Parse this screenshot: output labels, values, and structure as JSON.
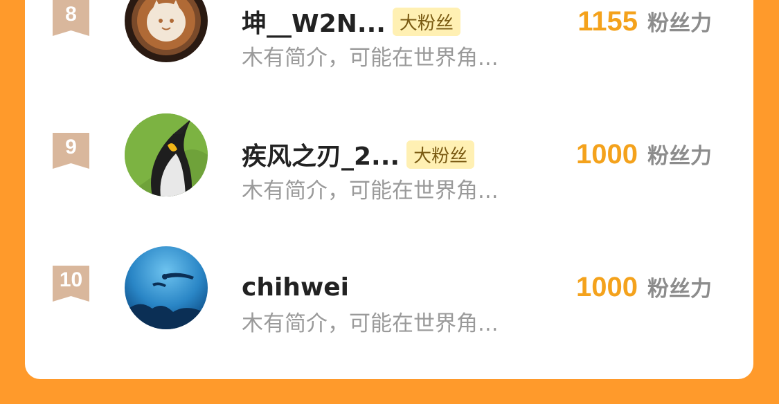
{
  "ranking": {
    "rows": [
      {
        "rank": "8",
        "name": "坤__W2N...",
        "badge": "大粉丝",
        "bio": "木有简介，可能在世界角...",
        "score": "1155",
        "score_unit": "粉丝力",
        "avatar_icon": "latte-art-cat-avatar"
      },
      {
        "rank": "9",
        "name": "疾风之刃_2...",
        "badge": "大粉丝",
        "bio": "木有简介，可能在世界角...",
        "score": "1000",
        "score_unit": "粉丝力",
        "avatar_icon": "penguin-avatar"
      },
      {
        "rank": "10",
        "name": "chihwei",
        "badge": "",
        "bio": "木有简介，可能在世界角...",
        "score": "1000",
        "score_unit": "粉丝力",
        "avatar_icon": "scuba-diver-avatar"
      }
    ]
  },
  "colors": {
    "background": "#FF9A2B",
    "score": "#F4A21C",
    "rank_ribbon": "#D9B79C",
    "badge_bg": "#FFF0B3"
  }
}
